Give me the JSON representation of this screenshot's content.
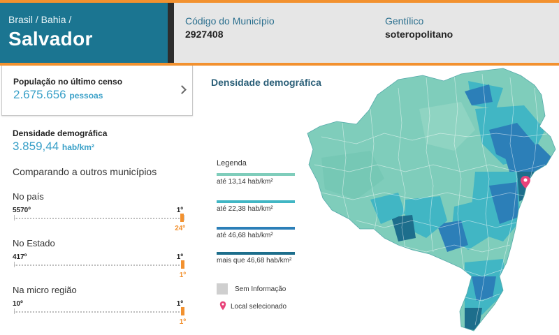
{
  "header": {
    "breadcrumb": "Brasil / Bahia /",
    "city": "Salvador",
    "codigo_label": "Código do Município",
    "codigo_value": "2927408",
    "gentilico_label": "Gentílico",
    "gentilico_value": "soteropolitano"
  },
  "populacao": {
    "label": "População no último censo",
    "value": "2.675.656",
    "unit": "pessoas"
  },
  "densidade": {
    "label": "Densidade demográfica",
    "value": "3.859,44",
    "unit": "hab/km²"
  },
  "comparando": {
    "title": "Comparando a outros municípios",
    "rows": [
      {
        "label": "No país",
        "total": "5570º",
        "first": "1º",
        "position": "24º",
        "rank_fraction": 0.996
      },
      {
        "label": "No Estado",
        "total": "417º",
        "first": "1º",
        "position": "1º",
        "rank_fraction": 1.0
      },
      {
        "label": "Na micro região",
        "total": "10º",
        "first": "1º",
        "position": "1º",
        "rank_fraction": 1.0
      }
    ]
  },
  "map": {
    "title": "Densidade demográfica",
    "legend": {
      "title": "Legenda",
      "items": [
        {
          "text": "até 13,14 hab/km²",
          "color": "#7fcdbb"
        },
        {
          "text": "até 22,38 hab/km²",
          "color": "#41b6c4"
        },
        {
          "text": "até 46,68 hab/km²",
          "color": "#2c7fb8"
        },
        {
          "text": "mais que 46,68 hab/km²",
          "color": "#1d6e8c"
        }
      ],
      "no_info": "Sem Informação",
      "no_info_color": "#cfcfcf",
      "local": "Local selecionado",
      "pin_color": "#e8437a"
    }
  },
  "colors": {
    "accent": "#f2912f",
    "brand": "#1b7591",
    "value_blue": "#39a0c8"
  }
}
